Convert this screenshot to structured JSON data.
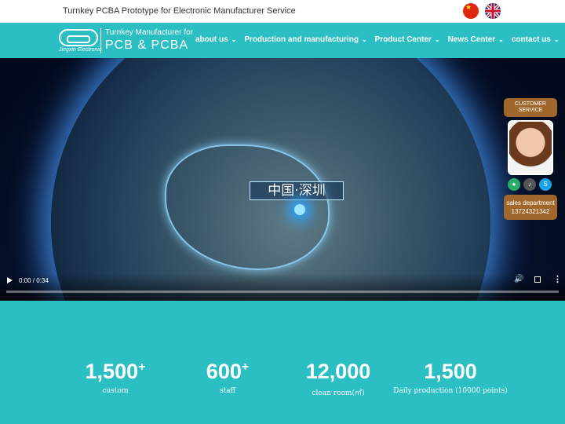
{
  "topbar": {
    "tagline": "Turnkey PCBA Prototype for Electronic Manufacturer Service",
    "languages": [
      {
        "name": "chinese-flag-icon",
        "color": "#de2910"
      },
      {
        "name": "uk-flag-icon",
        "color": "#012169"
      }
    ]
  },
  "logo": {
    "company": "Jingxin Electronic",
    "line1": "Turnkey Manufacturer for",
    "line2": "PCB & PCBA"
  },
  "nav": {
    "items": [
      {
        "label": "about us"
      },
      {
        "label": "Production and manufacturing"
      },
      {
        "label": "Product Center"
      },
      {
        "label": "News Center"
      },
      {
        "label": "contact us"
      }
    ]
  },
  "video": {
    "overlay_text": "中国·深圳",
    "time": "0:00 / 0:34",
    "progress": 0
  },
  "customer_service": {
    "title": "CUSTOMER SERVICE",
    "icons": [
      "wechat-icon",
      "tiktok-icon",
      "skype-icon"
    ],
    "department": "sales department",
    "phone": "13724321342"
  },
  "stats": [
    {
      "value": "1,500",
      "sup": "+",
      "label": "custom"
    },
    {
      "value": "600",
      "sup": "+",
      "label": "staff"
    },
    {
      "value": "12,000",
      "sup": "",
      "label": "clean room(㎡)"
    },
    {
      "value": "1,500",
      "sup": "",
      "label": "Daily production (10000 points)"
    }
  ],
  "colors": {
    "accent": "#2bbfc4",
    "cs_brown": "#a0672c"
  }
}
